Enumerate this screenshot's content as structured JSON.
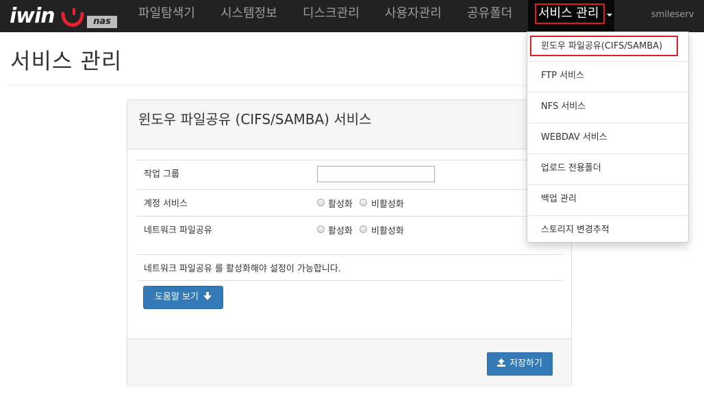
{
  "navbar": {
    "logo_text": "iwin",
    "logo_badge": "nas",
    "items": [
      "파일탐색기",
      "시스템정보",
      "디스크관리",
      "사용자관리",
      "공유폴더"
    ],
    "active_item": "서비스 관리",
    "user": "smileserv"
  },
  "page": {
    "title": "서비스 관리"
  },
  "panel": {
    "title": "윈도우 파일공유 (CIFS/SAMBA) 서비스",
    "rows": [
      {
        "label": "작업 그룹",
        "input_value": ""
      },
      {
        "label": "계정 서비스",
        "option_on": "활성화",
        "option_off": "비활성화"
      },
      {
        "label": "네트워크 파일공유",
        "option_on": "활성화",
        "option_off": "비활성화"
      }
    ],
    "info_text": "네트워크 파일공유 를 활성화해야 설정이 가능합니다.",
    "help_button": "도움말 보기",
    "save_button": "저장하기"
  },
  "dropdown": {
    "items": [
      "윈도우 파일공유(CIFS/SAMBA)",
      "FTP 서비스",
      "NFS 서비스",
      "WEBDAV 서비스",
      "업로드 전용폴더",
      "백업 관리",
      "스토리지 변경추적"
    ]
  },
  "colors": {
    "navbar_bg": "#222222",
    "highlight": "#e01b24",
    "primary_button": "#337ab7",
    "logo_smile": "#e8212e"
  }
}
